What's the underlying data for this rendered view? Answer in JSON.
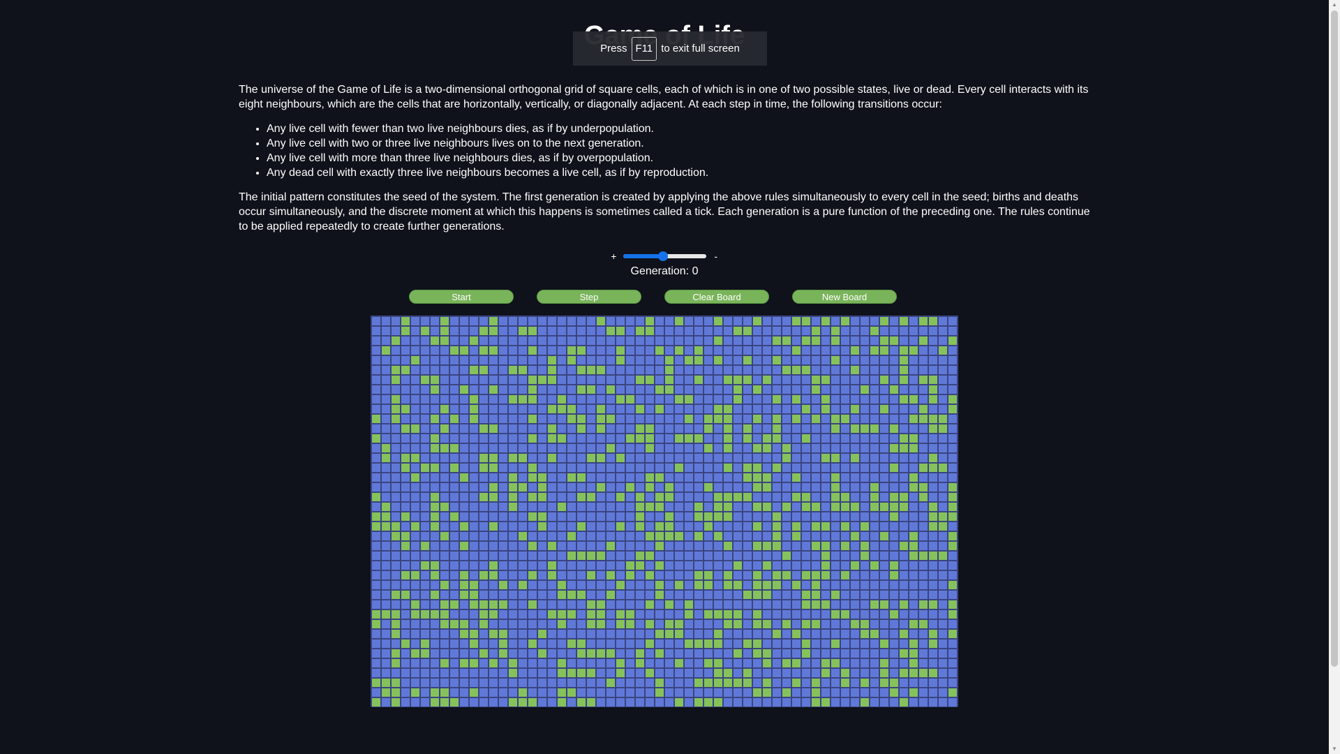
{
  "page": {
    "title": "Game of Life",
    "fullscreen_notice": {
      "prefix": "Press",
      "key": "F11",
      "suffix": "to exit full screen"
    }
  },
  "description": {
    "intro": "The universe of the Game of Life is a two-dimensional orthogonal grid of square cells, each of which is in one of two possible states, live or dead. Every cell interacts with its eight neighbours, which are the cells that are horizontally, vertically, or diagonally adjacent. At each step in time, the following transitions occur:",
    "rules": [
      "Any live cell with fewer than two live neighbours dies, as if by underpopulation.",
      "Any live cell with two or three live neighbours lives on to the next generation.",
      "Any live cell with more than three live neighbours dies, as if by overpopulation.",
      "Any dead cell with exactly three live neighbours becomes a live cell, as if by reproduction."
    ],
    "outro": "The initial pattern constitutes the seed of the system. The first generation is created by applying the above rules simultaneously to every cell in the seed; births and deaths occur simultaneously, and the discrete moment at which this happens is sometimes called a tick. Each generation is a pure function of the preceding one. The rules continue to be applied repeatedly to create further generations."
  },
  "speed": {
    "plus_label": "+",
    "minus_label": "-",
    "value_fraction": 0.48,
    "color": "#1572e8"
  },
  "generation": {
    "text": "Generation: 0"
  },
  "controls": {
    "start_label": "Start",
    "step_label": "Step",
    "clear_label": "Clear Board",
    "new_label": "New Board",
    "button_color": "#79b45a"
  },
  "board": {
    "columns": 60,
    "rows": 40,
    "live_color": "#86c25c",
    "dead_color": "#6079d8",
    "live_density": 0.3,
    "seed": 20240519
  }
}
